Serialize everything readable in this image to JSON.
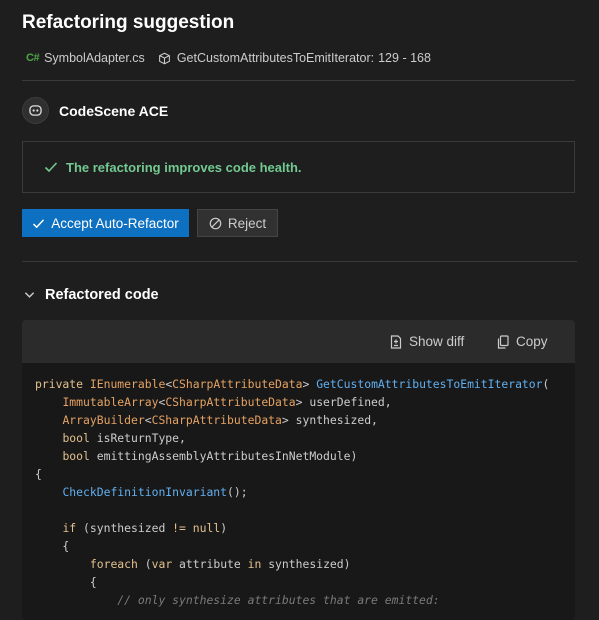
{
  "header": {
    "title": "Refactoring suggestion",
    "lang_badge": "C#",
    "file_name": "SymbolAdapter.cs",
    "method_ref": "GetCustomAttributesToEmitIterator:",
    "line_range": "129 - 168"
  },
  "assistant": {
    "name": "CodeScene ACE",
    "avatar_icon": "robot-icon"
  },
  "health": {
    "message": "The refactoring improves code health.",
    "color": "#73c991"
  },
  "actions": {
    "accept_label": "Accept Auto-Refactor",
    "reject_label": "Reject",
    "accent": "#0e70c0"
  },
  "section": {
    "title": "Refactored code",
    "expanded": true
  },
  "toolbar": {
    "show_diff_label": "Show diff",
    "copy_label": "Copy"
  },
  "code_lines": [
    [
      [
        "kw",
        "private "
      ],
      [
        "ty",
        "IEnumerable"
      ],
      [
        "pl",
        "<"
      ],
      [
        "ty",
        "CSharpAttributeData"
      ],
      [
        "pl",
        "> "
      ],
      [
        "fn",
        "GetCustomAttributesToEmitIterator"
      ],
      [
        "pl",
        "("
      ]
    ],
    [
      [
        "pl",
        "    "
      ],
      [
        "ty",
        "ImmutableArray"
      ],
      [
        "pl",
        "<"
      ],
      [
        "ty",
        "CSharpAttributeData"
      ],
      [
        "pl",
        "> userDefined,"
      ]
    ],
    [
      [
        "pl",
        "    "
      ],
      [
        "ty",
        "ArrayBuilder"
      ],
      [
        "pl",
        "<"
      ],
      [
        "ty",
        "CSharpAttributeData"
      ],
      [
        "pl",
        "> synthesized,"
      ]
    ],
    [
      [
        "pl",
        "    "
      ],
      [
        "kw",
        "bool "
      ],
      [
        "pl",
        "isReturnType,"
      ]
    ],
    [
      [
        "pl",
        "    "
      ],
      [
        "kw",
        "bool "
      ],
      [
        "pl",
        "emittingAssemblyAttributesInNetModule)"
      ]
    ],
    [
      [
        "pl",
        "{"
      ]
    ],
    [
      [
        "pl",
        "    "
      ],
      [
        "fn",
        "CheckDefinitionInvariant"
      ],
      [
        "pl",
        "();"
      ]
    ],
    [
      [
        "pl",
        ""
      ]
    ],
    [
      [
        "pl",
        "    "
      ],
      [
        "kw",
        "if "
      ],
      [
        "pl",
        "(synthesized "
      ],
      [
        "kw",
        "!= null"
      ],
      [
        "pl",
        ")"
      ]
    ],
    [
      [
        "pl",
        "    {"
      ]
    ],
    [
      [
        "pl",
        "        "
      ],
      [
        "kw",
        "foreach "
      ],
      [
        "pl",
        "("
      ],
      [
        "kw",
        "var "
      ],
      [
        "pl",
        "attribute "
      ],
      [
        "kw",
        "in "
      ],
      [
        "pl",
        "synthesized)"
      ]
    ],
    [
      [
        "pl",
        "        {"
      ]
    ],
    [
      [
        "cm",
        "            // only synthesize attributes that are emitted:"
      ]
    ]
  ]
}
